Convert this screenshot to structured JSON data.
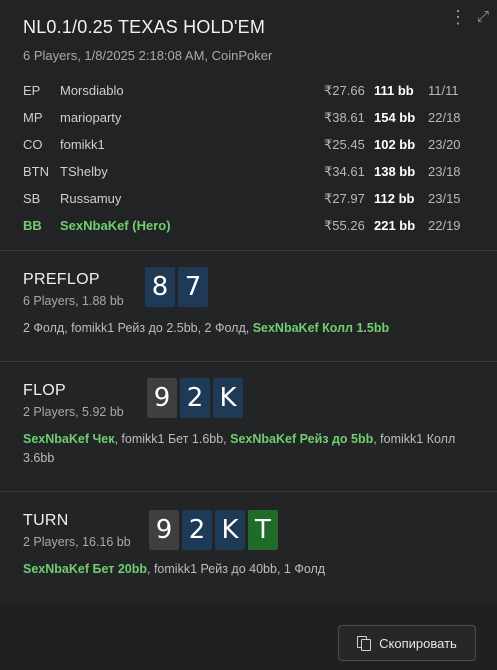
{
  "header": {
    "title": "NL0.1/0.25 TEXAS HOLD'EM",
    "subtitle": "6 Players, 1/8/2025 2:18:08 AM, CoinPoker",
    "more_icon": "more-vertical-icon",
    "expand_icon": "expand-icon"
  },
  "players": [
    {
      "pos": "EP",
      "name": "Morsdiablo",
      "amount": "₹27.66",
      "bb": "111 bb",
      "stat": "11/11",
      "hero": false
    },
    {
      "pos": "MP",
      "name": "marioparty",
      "amount": "₹38.61",
      "bb": "154 bb",
      "stat": "22/18",
      "hero": false
    },
    {
      "pos": "CO",
      "name": "fomikk1",
      "amount": "₹25.45",
      "bb": "102 bb",
      "stat": "23/20",
      "hero": false
    },
    {
      "pos": "BTN",
      "name": "TShelby",
      "amount": "₹34.61",
      "bb": "138 bb",
      "stat": "23/18",
      "hero": false
    },
    {
      "pos": "SB",
      "name": "Russamuy",
      "amount": "₹27.97",
      "bb": "112 bb",
      "stat": "23/15",
      "hero": false
    },
    {
      "pos": "BB",
      "name": "SexNbaKef (Hero)",
      "amount": "₹55.26",
      "bb": "221 bb",
      "stat": "22/19",
      "hero": true
    }
  ],
  "streets": {
    "preflop": {
      "name": "PREFLOP",
      "sub": "6 Players, 1.88 bb",
      "cards": [
        {
          "rank": "8",
          "color": "blue"
        },
        {
          "rank": "7",
          "color": "blue"
        }
      ],
      "actions": [
        {
          "text": "2 Фолд, fomikk1 Рейз до 2.5bb, 2 Фолд, ",
          "hero": false
        },
        {
          "text": "SexNbaKef Колл 1.5bb",
          "hero": true
        }
      ]
    },
    "flop": {
      "name": "FLOP",
      "sub": "2 Players, 5.92 bb",
      "cards": [
        {
          "rank": "9",
          "color": "gray"
        },
        {
          "rank": "2",
          "color": "blue"
        },
        {
          "rank": "K",
          "color": "blue"
        }
      ],
      "actions": [
        {
          "text": "SexNbaKef Чек",
          "hero": true
        },
        {
          "text": ", fomikk1 Бет 1.6bb, ",
          "hero": false
        },
        {
          "text": "SexNbaKef Рейз до 5bb",
          "hero": true
        },
        {
          "text": ", fomikk1 Колл 3.6bb",
          "hero": false
        }
      ]
    },
    "turn": {
      "name": "TURN",
      "sub": "2 Players, 16.16 bb",
      "cards": [
        {
          "rank": "9",
          "color": "gray"
        },
        {
          "rank": "2",
          "color": "blue"
        },
        {
          "rank": "K",
          "color": "blue"
        },
        {
          "rank": "T",
          "color": "green"
        }
      ],
      "actions": [
        {
          "text": "SexNbaKef Бет 20bb",
          "hero": true
        },
        {
          "text": ", fomikk1 Рейз до 40bb, 1 Фолд",
          "hero": false
        }
      ]
    }
  },
  "footer": {
    "copy_label": "Скопировать",
    "copy_icon": "copy-icon"
  },
  "colors": {
    "hero": "#6fcf6f",
    "card_blue": "#1e3a57",
    "card_gray": "#3f3f3f",
    "card_green": "#1f6b2a"
  }
}
